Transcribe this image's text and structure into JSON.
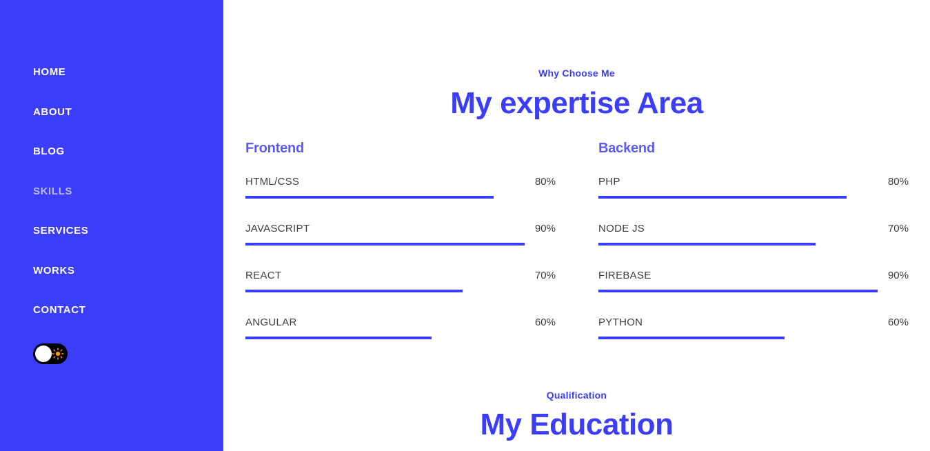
{
  "theme": {
    "sidebar_bg": "#3b3df8",
    "accent": "#3b3df8",
    "heading_accent": "#5a5bf0",
    "text": "#3d3d3d",
    "nav_active": "#b9bcfb",
    "toggle_bg": "#000000",
    "toggle_knob": "#ffffff",
    "sun_color": "#f59314"
  },
  "sidebar": {
    "items": [
      {
        "label": "HOME",
        "active": false
      },
      {
        "label": "ABOUT",
        "active": false
      },
      {
        "label": "BLOG",
        "active": false
      },
      {
        "label": "SKILLS",
        "active": true
      },
      {
        "label": "SERVICES",
        "active": false
      },
      {
        "label": "WORKS",
        "active": false
      },
      {
        "label": "CONTACT",
        "active": false
      }
    ],
    "theme_toggle": {
      "name": "dark-mode-toggle",
      "state": "off",
      "knob_icon": "circle-knob",
      "mode_icon": "sun-icon"
    }
  },
  "expertise": {
    "eyebrow": "Why Choose Me",
    "title": "My expertise Area",
    "columns": [
      {
        "heading": "Frontend",
        "skills": [
          {
            "name": "HTML/CSS",
            "percent": 80,
            "percent_label": "80%"
          },
          {
            "name": "JAVASCRIPT",
            "percent": 90,
            "percent_label": "90%"
          },
          {
            "name": "REACT",
            "percent": 70,
            "percent_label": "70%"
          },
          {
            "name": "ANGULAR",
            "percent": 60,
            "percent_label": "60%"
          }
        ]
      },
      {
        "heading": "Backend",
        "skills": [
          {
            "name": "PHP",
            "percent": 80,
            "percent_label": "80%"
          },
          {
            "name": "NODE JS",
            "percent": 70,
            "percent_label": "70%"
          },
          {
            "name": "FIREBASE",
            "percent": 90,
            "percent_label": "90%"
          },
          {
            "name": "PYTHON",
            "percent": 60,
            "percent_label": "60%"
          }
        ]
      }
    ]
  },
  "education": {
    "eyebrow": "Qualification",
    "title": "My Education"
  }
}
